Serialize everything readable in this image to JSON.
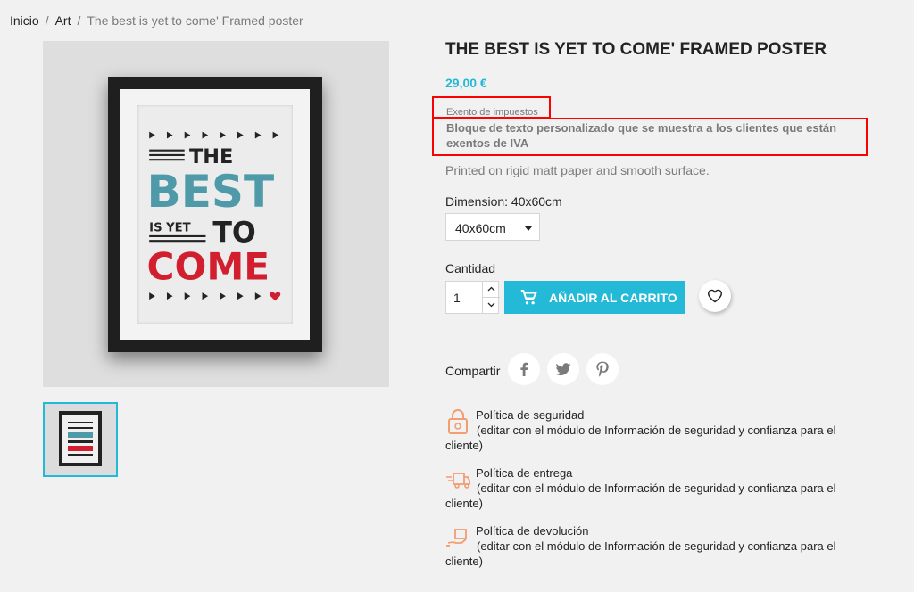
{
  "breadcrumb": {
    "items": [
      "Inicio",
      "Art",
      "The best is yet to come' Framed poster"
    ],
    "separator": "/"
  },
  "product": {
    "title": "The best is yet to come' Framed poster",
    "price": "29,00 €",
    "tax_label": "Exento de impuestos",
    "custom_text": "Bloque de texto personalizado que se muestra a los clientes que están exentos de IVA",
    "description": "Printed on rigid matt paper and smooth surface.",
    "poster_words": [
      "THE",
      "BEST",
      "IS YET",
      "TO",
      "COME"
    ]
  },
  "variant": {
    "label": "Dimension: 40x60cm",
    "selected": "40x60cm"
  },
  "quantity": {
    "label": "Cantidad",
    "value": "1"
  },
  "cart": {
    "button_label": "Añadir al carrito"
  },
  "share": {
    "label": "Compartir",
    "networks": [
      "facebook-icon",
      "twitter-icon",
      "pinterest-icon"
    ]
  },
  "reassurance": [
    {
      "icon": "lock-icon",
      "title": "Política de seguridad",
      "note": "(editar con el módulo de Información de seguridad y confianza para el cliente)"
    },
    {
      "icon": "truck-icon",
      "title": "Política de entrega",
      "note": "(editar con el módulo de Información de seguridad y confianza para el cliente)"
    },
    {
      "icon": "return-icon",
      "title": "Política de devolución",
      "note": "(editar con el módulo de Información de seguridad y confianza para el cliente)"
    }
  ],
  "colors": {
    "accent": "#24b9d7",
    "highlight_border": "#ff0000",
    "poster_blue": "#4e9aa8",
    "poster_red": "#d11f2f",
    "icon_orange": "#f39d72"
  }
}
